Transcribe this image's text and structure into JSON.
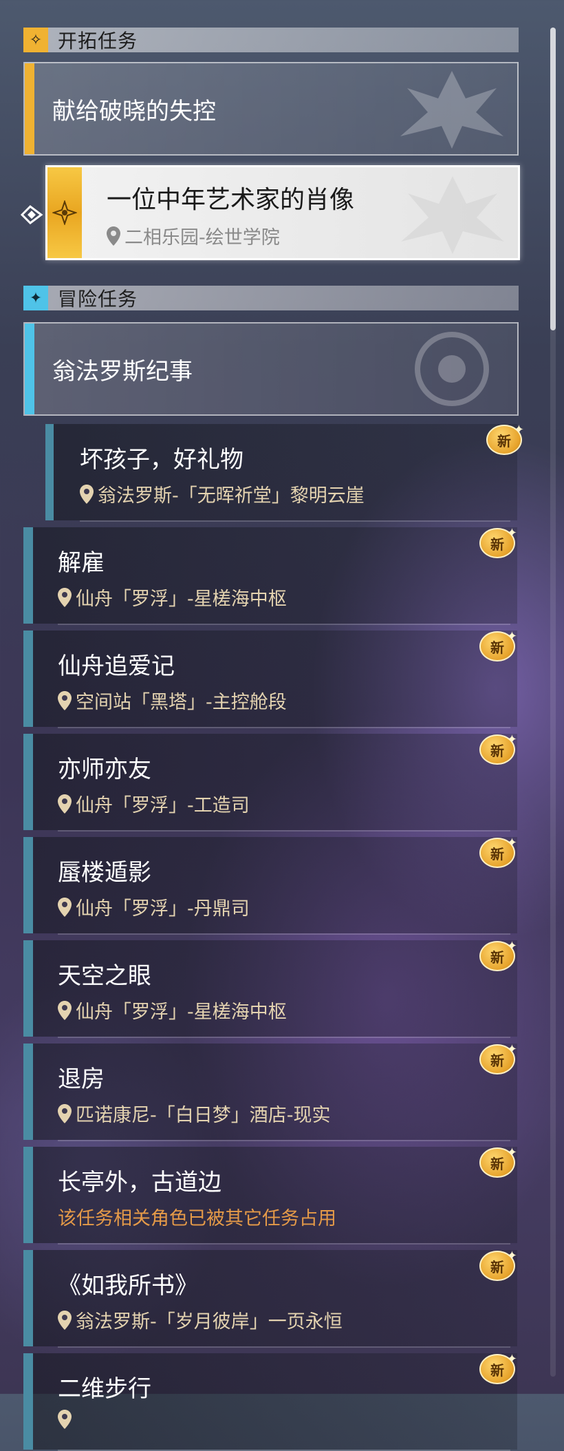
{
  "sections": {
    "trailblaze": {
      "title": "开拓任务",
      "icon": "trailblaze-mission-icon"
    },
    "adventure": {
      "title": "冒险任务",
      "icon": "adventure-mission-icon"
    }
  },
  "trailblaze_group": {
    "title": "献给破晓的失控"
  },
  "trailblaze_current": {
    "title": "一位中年艺术家的肖像",
    "location": "二相乐园-绘世学院"
  },
  "adventure_group": {
    "title": "翁法罗斯纪事"
  },
  "badge_label": "新",
  "quests": [
    {
      "title": "坏孩子，好礼物",
      "location": "翁法罗斯-「无晖祈堂」黎明云崖",
      "new": true,
      "sub": true
    },
    {
      "title": "解雇",
      "location": "仙舟「罗浮」-星槎海中枢",
      "new": true
    },
    {
      "title": "仙舟追爱记",
      "location": "空间站「黑塔」-主控舱段",
      "new": true
    },
    {
      "title": "亦师亦友",
      "location": "仙舟「罗浮」-工造司",
      "new": true
    },
    {
      "title": "蜃楼遁影",
      "location": "仙舟「罗浮」-丹鼎司",
      "new": true
    },
    {
      "title": "天空之眼",
      "location": "仙舟「罗浮」-星槎海中枢",
      "new": true
    },
    {
      "title": "退房",
      "location": "匹诺康尼-「白日梦」酒店-现实",
      "new": true
    },
    {
      "title": "长亭外，古道边",
      "location": "该任务相关角色已被其它任务占用",
      "new": true,
      "warning": true
    },
    {
      "title": "《如我所书》",
      "location": "翁法罗斯-「岁月彼岸」一页永恒",
      "new": true
    },
    {
      "title": "二维步行",
      "location": "",
      "new": true
    }
  ],
  "colors": {
    "gold": "#f0b232",
    "teal": "#4a8ca3",
    "cyan": "#4fc3e8",
    "location_text": "#e4d3b0",
    "warning_text": "#e59a48"
  }
}
